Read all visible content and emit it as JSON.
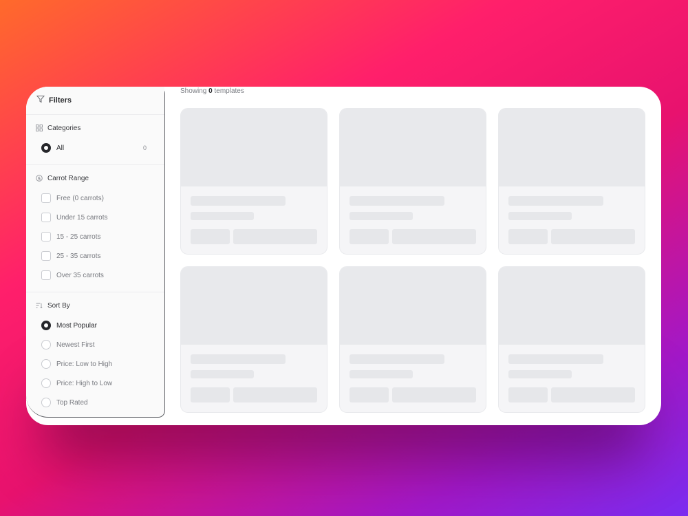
{
  "sidebar": {
    "header_title": "Filters",
    "categories": {
      "title": "Categories",
      "items": [
        {
          "label": "All",
          "count": "0"
        }
      ]
    },
    "carrot_range": {
      "title": "Carrot Range",
      "items": [
        {
          "label": "Free (0 carrots)"
        },
        {
          "label": "Under 15 carrots"
        },
        {
          "label": "15 - 25 carrots"
        },
        {
          "label": "25 - 35 carrots"
        },
        {
          "label": "Over 35 carrots"
        }
      ]
    },
    "sort_by": {
      "title": "Sort By",
      "items": [
        {
          "label": "Most Popular"
        },
        {
          "label": "Newest First"
        },
        {
          "label": "Price: Low to High"
        },
        {
          "label": "Price: High to Low"
        },
        {
          "label": "Top Rated"
        }
      ]
    }
  },
  "main": {
    "showing_prefix": "Showing",
    "showing_count": "0",
    "showing_suffix": "templates"
  },
  "colors": {
    "accent": "#26272b",
    "skeleton": "#e8e9ec"
  }
}
